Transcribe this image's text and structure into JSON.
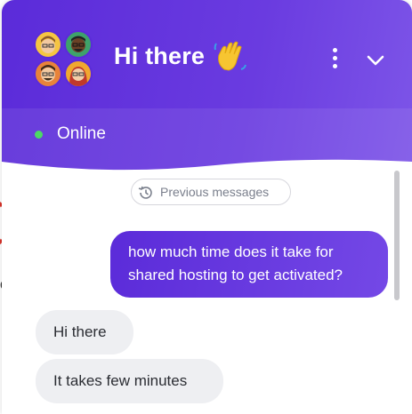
{
  "header": {
    "title": "Hi there",
    "wave_emoji": "waving-hand",
    "menu_icon": "more-vertical-icon",
    "collapse_icon": "chevron-down-icon"
  },
  "status": {
    "label": "Online",
    "color": "#4cd964"
  },
  "history": {
    "label": "Previous messages",
    "icon": "history-icon"
  },
  "messages": [
    {
      "from": "user",
      "text": "how much time does it take for shared hosting to get activated?"
    },
    {
      "from": "agent",
      "text": "Hi there"
    },
    {
      "from": "agent",
      "text": "It takes few minutes"
    }
  ],
  "colors": {
    "brand_start": "#5b2bd9",
    "brand_end": "#7d55e8",
    "agent_bubble": "#eeeff2"
  }
}
